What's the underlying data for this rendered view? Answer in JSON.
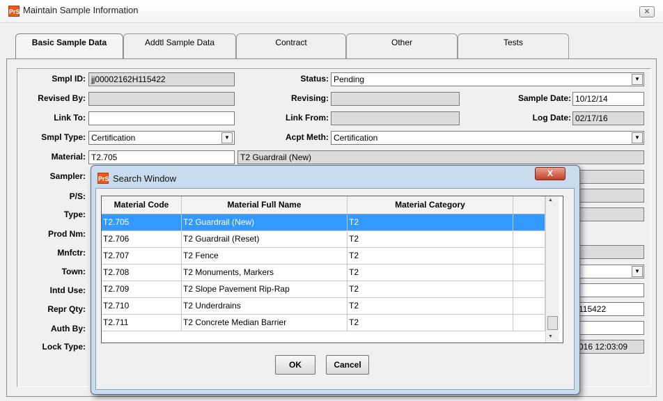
{
  "window": {
    "title": "Maintain Sample Information",
    "close_label": "✕",
    "app_icon_text": "PrS"
  },
  "tabs": [
    {
      "label": "Basic Sample Data",
      "active": true
    },
    {
      "label": "Addtl Sample Data",
      "active": false
    },
    {
      "label": "Contract",
      "active": false
    },
    {
      "label": "Other",
      "active": false
    },
    {
      "label": "Tests",
      "active": false
    }
  ],
  "form": {
    "smpl_id": {
      "label": "Smpl ID:",
      "value": "jj00002162H115422"
    },
    "status": {
      "label": "Status:",
      "value": "Pending"
    },
    "revised_by": {
      "label": "Revised By:",
      "value": ""
    },
    "revising": {
      "label": "Revising:",
      "value": ""
    },
    "sample_date": {
      "label": "Sample Date:",
      "value": "10/12/14"
    },
    "link_to": {
      "label": "Link To:",
      "value": ""
    },
    "link_from": {
      "label": "Link From:",
      "value": ""
    },
    "log_date": {
      "label": "Log Date:",
      "value": "02/17/16"
    },
    "smpl_type": {
      "label": "Smpl Type:",
      "value": "Certification"
    },
    "acpt_meth": {
      "label": "Acpt Meth:",
      "value": "Certification"
    },
    "material": {
      "label": "Material:",
      "value": "T2.705",
      "description": "T2 Guardrail (New)"
    },
    "sampler": {
      "label": "Sampler:"
    },
    "ps": {
      "label": "P/S:"
    },
    "type": {
      "label": "Type:"
    },
    "prod_nm": {
      "label": "Prod Nm:"
    },
    "mnfctr": {
      "label": "Mnfctr:"
    },
    "town": {
      "label": "Town:"
    },
    "intd_use": {
      "label": "Intd Use:"
    },
    "repr_qty": {
      "label": "Repr Qty:",
      "partial_value": "115422"
    },
    "auth_by": {
      "label": "Auth By:"
    },
    "lock_type": {
      "label": "Lock Type:",
      "partial_value": "016 12:03:09"
    }
  },
  "dropdown_arrow": "▼",
  "search_window": {
    "title": "Search Window",
    "close_label": "X",
    "columns": [
      "Material Code",
      "Material Full Name",
      "Material Category"
    ],
    "rows": [
      {
        "code": "T2.705",
        "name": "T2 Guardrail (New)",
        "category": "T2",
        "selected": true
      },
      {
        "code": "T2.706",
        "name": "T2 Guardrail (Reset)",
        "category": "T2",
        "selected": false
      },
      {
        "code": "T2.707",
        "name": "T2 Fence",
        "category": "T2",
        "selected": false
      },
      {
        "code": "T2.708",
        "name": "T2 Monuments, Markers",
        "category": "T2",
        "selected": false
      },
      {
        "code": "T2.709",
        "name": "T2 Slope Pavement Rip-Rap",
        "category": "T2",
        "selected": false
      },
      {
        "code": "T2.710",
        "name": "T2 Underdrains",
        "category": "T2",
        "selected": false
      },
      {
        "code": "T2.711",
        "name": "T2 Concrete Median Barrier",
        "category": "T2",
        "selected": false
      }
    ],
    "ok_label": "OK",
    "cancel_label": "Cancel",
    "scroll_up": "▲",
    "scroll_down": "▼"
  }
}
